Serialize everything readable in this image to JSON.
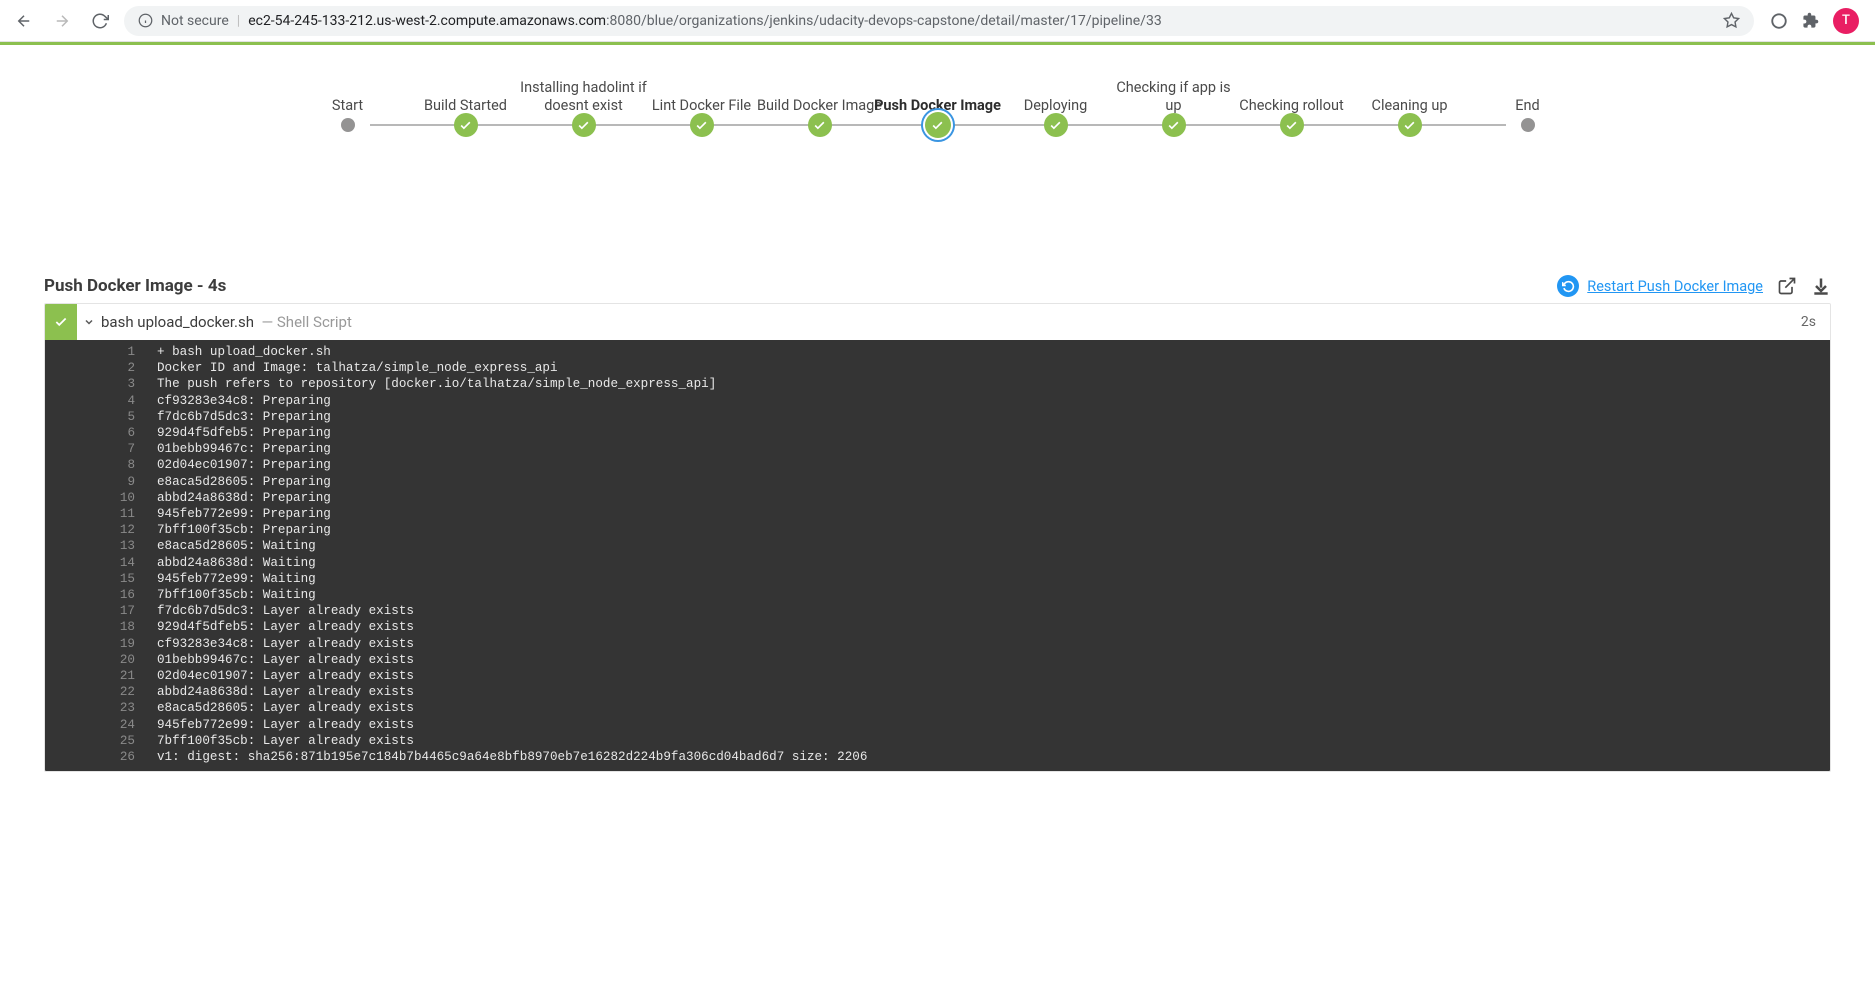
{
  "browser": {
    "security_label": "Not secure",
    "host": "ec2-54-245-133-212.us-west-2.compute.amazonaws.com",
    "port": ":8080",
    "path": "/blue/organizations/jenkins/udacity-devops-capstone/detail/master/17/pipeline/33",
    "avatar_letter": "T"
  },
  "pipeline": {
    "stages": [
      {
        "label": "Start",
        "type": "terminal"
      },
      {
        "label": "Build Started",
        "type": "ok"
      },
      {
        "label": "Installing hadolint if doesnt exist",
        "type": "ok"
      },
      {
        "label": "Lint Docker File",
        "type": "ok"
      },
      {
        "label": "Build Docker Image",
        "type": "ok"
      },
      {
        "label": "Push Docker Image",
        "type": "ok",
        "selected": true
      },
      {
        "label": "Deploying",
        "type": "ok"
      },
      {
        "label": "Checking if app is up",
        "type": "ok"
      },
      {
        "label": "Checking rollout",
        "type": "ok"
      },
      {
        "label": "Cleaning up",
        "type": "ok"
      },
      {
        "label": "End",
        "type": "terminal"
      }
    ]
  },
  "stage_detail": {
    "title": "Push Docker Image - 4s",
    "restart_label": "Restart Push Docker Image"
  },
  "log": {
    "command": "bash upload_docker.sh",
    "subtitle": "— Shell Script",
    "duration": "2s",
    "lines": [
      "+ bash upload_docker.sh",
      "Docker ID and Image: talhatza/simple_node_express_api",
      "The push refers to repository [docker.io/talhatza/simple_node_express_api]",
      "cf93283e34c8: Preparing",
      "f7dc6b7d5dc3: Preparing",
      "929d4f5dfeb5: Preparing",
      "01bebb99467c: Preparing",
      "02d04ec01907: Preparing",
      "e8aca5d28605: Preparing",
      "abbd24a8638d: Preparing",
      "945feb772e99: Preparing",
      "7bff100f35cb: Preparing",
      "e8aca5d28605: Waiting",
      "abbd24a8638d: Waiting",
      "945feb772e99: Waiting",
      "7bff100f35cb: Waiting",
      "f7dc6b7d5dc3: Layer already exists",
      "929d4f5dfeb5: Layer already exists",
      "cf93283e34c8: Layer already exists",
      "01bebb99467c: Layer already exists",
      "02d04ec01907: Layer already exists",
      "abbd24a8638d: Layer already exists",
      "e8aca5d28605: Layer already exists",
      "945feb772e99: Layer already exists",
      "7bff100f35cb: Layer already exists",
      "v1: digest: sha256:871b195e7c184b7b4465c9a64e8bfb8970eb7e16282d224b9fa306cd04bad6d7 size: 2206"
    ]
  }
}
